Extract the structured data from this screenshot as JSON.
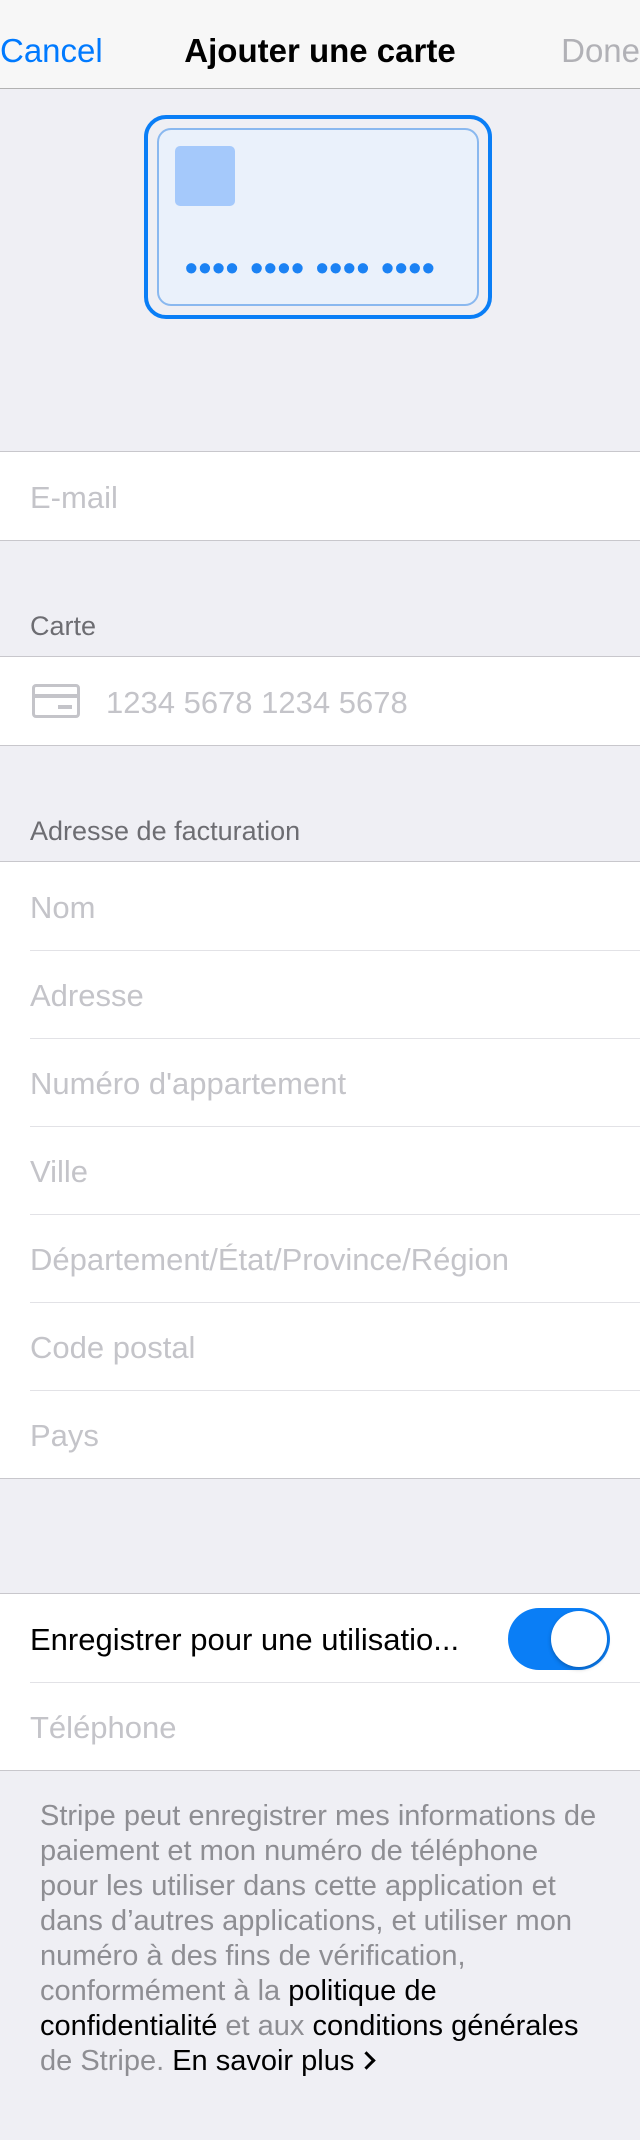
{
  "nav": {
    "cancel": "Cancel",
    "title": "Ajouter une carte",
    "done": "Done"
  },
  "card_preview": {
    "dots": "•••• •••• •••• ••••"
  },
  "email": {
    "placeholder": "E-mail"
  },
  "card_section": {
    "label": "Carte",
    "number_placeholder": "1234 5678 1234 5678"
  },
  "billing": {
    "label": "Adresse de facturation",
    "fields": [
      "Nom",
      "Adresse",
      "Numéro d'appartement",
      "Ville",
      "Département/État/Province/Région",
      "Code postal",
      "Pays"
    ]
  },
  "save": {
    "label": "Enregistrer pour une utilisatio...",
    "toggle_on": true,
    "phone_placeholder": "Téléphone"
  },
  "footer": {
    "text_1": "Stripe peut enregistrer mes informations de paiement et mon numéro de téléphone pour les utiliser dans cette application et dans d’autres applications, et utiliser mon numéro à des fins de vérification, conformément à la ",
    "privacy_link": "politique de confidentialité",
    "text_2": " et aux ",
    "terms_link": "conditions générales",
    "text_3": " de Stripe. ",
    "learn_more": "En savoir plus"
  },
  "colors": {
    "accent": "#007aff",
    "background": "#efeff4"
  }
}
